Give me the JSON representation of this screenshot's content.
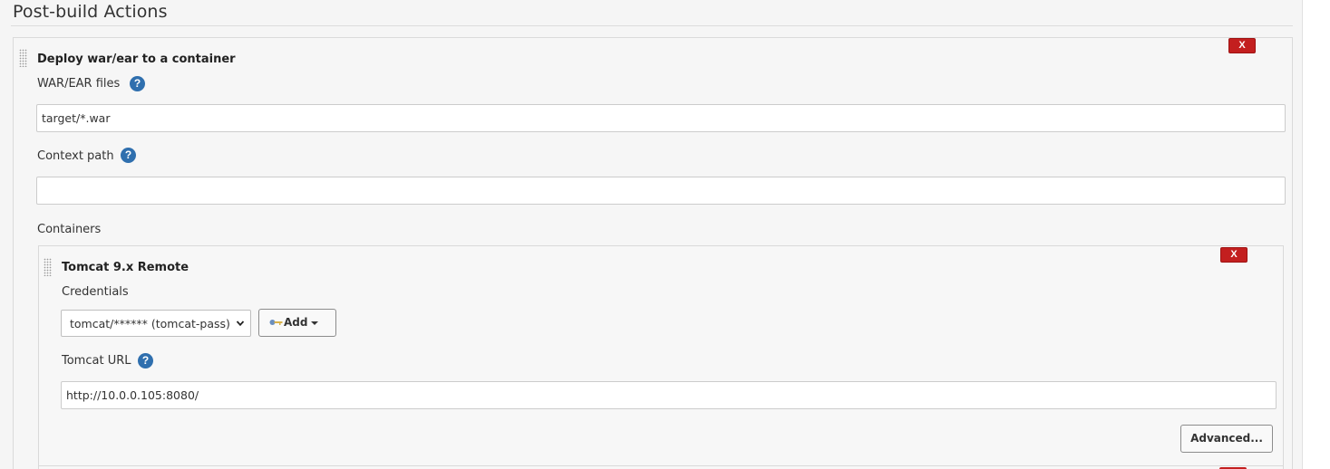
{
  "section": {
    "title": "Post-build Actions"
  },
  "deploy": {
    "title": "Deploy war/ear to a container",
    "remove_label": "X",
    "war_files": {
      "label": "WAR/EAR files",
      "value": "target/*.war"
    },
    "context_path": {
      "label": "Context path",
      "value": ""
    },
    "containers_label": "Containers"
  },
  "tomcat": {
    "title": "Tomcat 9.x Remote",
    "remove_label": "X",
    "credentials": {
      "label": "Credentials",
      "selected": "tomcat/****** (tomcat-pass)"
    },
    "add_button": "Add",
    "url": {
      "label": "Tomcat URL",
      "value": "http://10.0.0.105:8080/"
    },
    "advanced_button": "Advanced..."
  },
  "icons": {
    "help": "help-icon",
    "drag": "drag-handle-icon",
    "key": "key-icon",
    "dropdown": "chevron-down-icon"
  },
  "colors": {
    "remove_button": "#c31f1f",
    "help_icon": "#2f6fae"
  }
}
